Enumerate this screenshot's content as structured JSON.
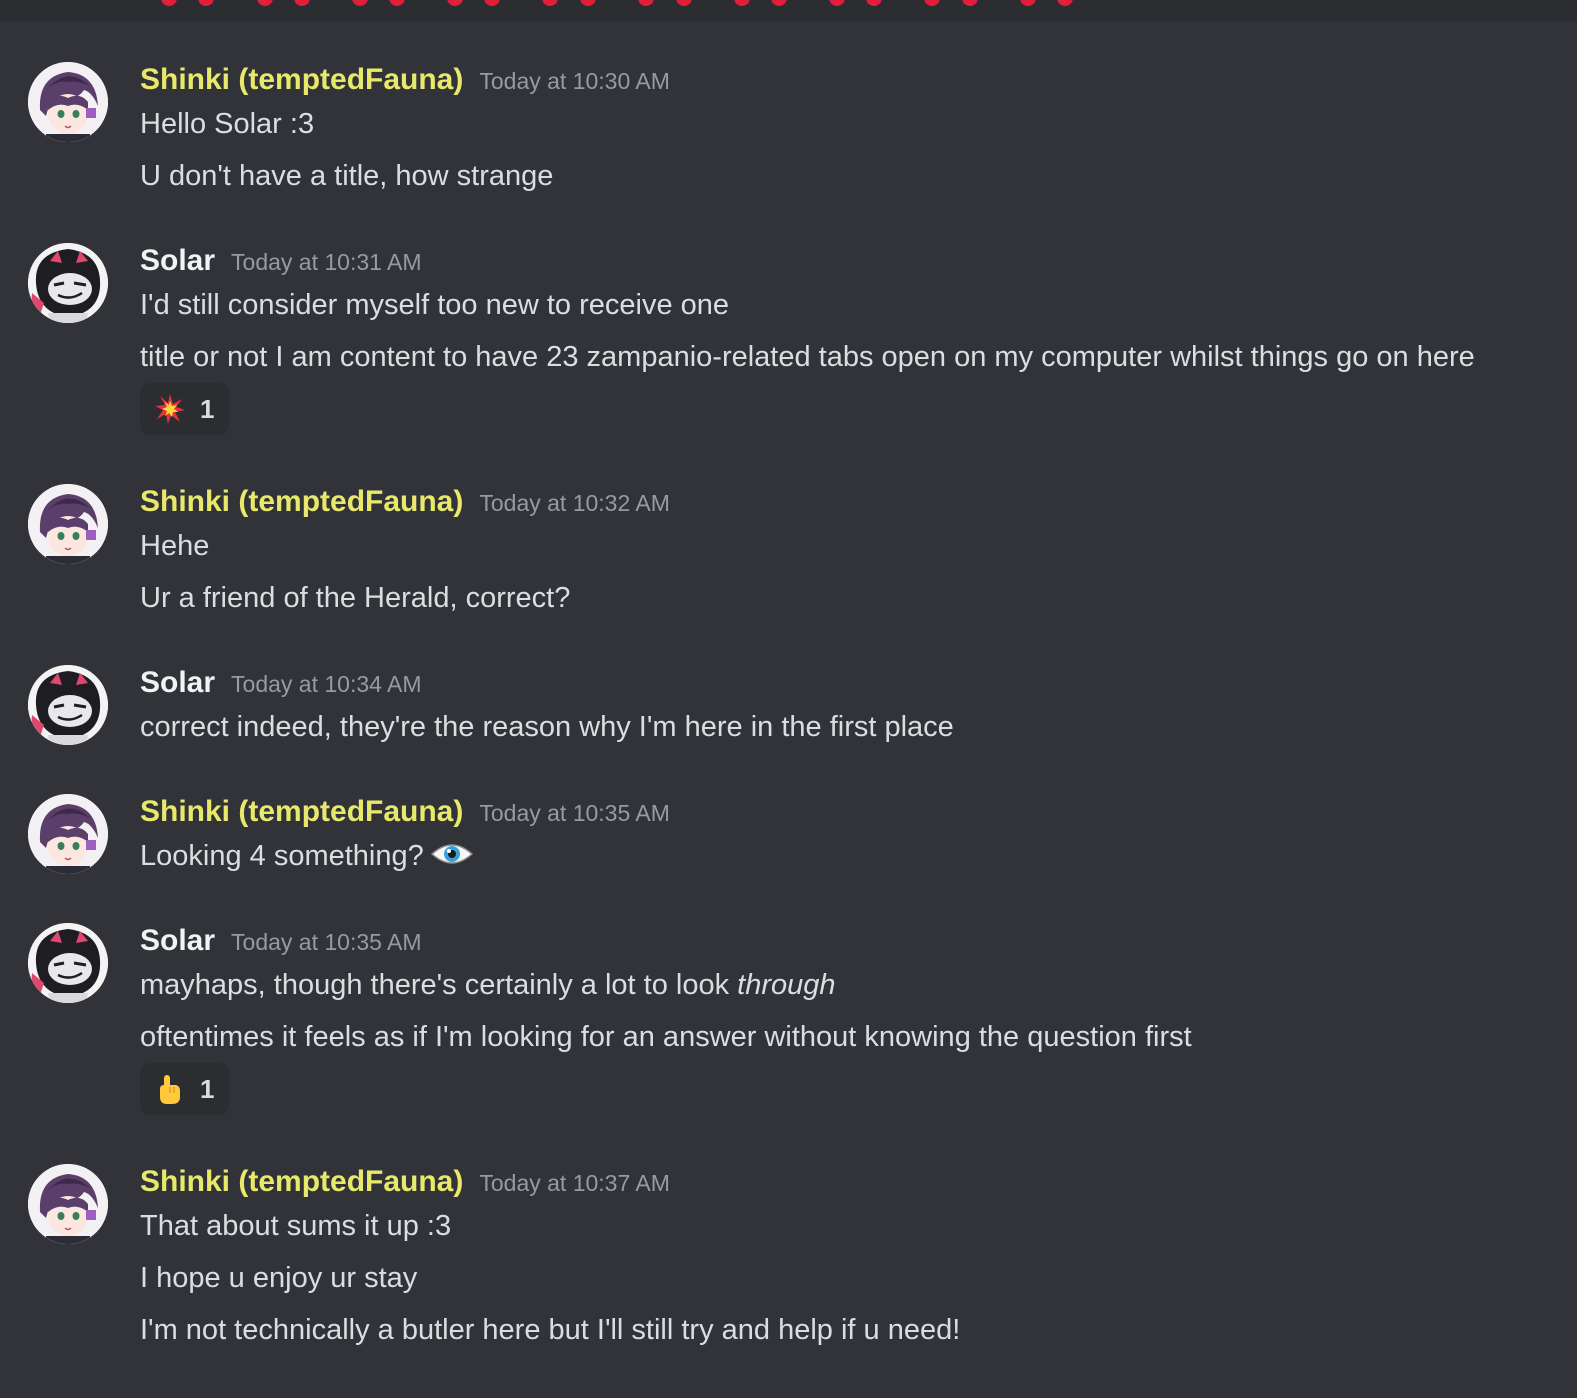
{
  "theme": {
    "background": "#313338",
    "shinki_color": "#e8e86b",
    "solar_color": "#f2f3f5",
    "timestamp_color": "#949ba4",
    "dots_color": "#e0203a"
  },
  "messages": [
    {
      "author": "Shinki (temptedFauna)",
      "avatar_icon": "shinki-avatar-icon",
      "timestamp": "Today at 10:30 AM",
      "lines": [
        "Hello Solar :3",
        "U don't have a title, how strange"
      ]
    },
    {
      "author": "Solar",
      "avatar_icon": "solar-avatar-icon",
      "timestamp": "Today at 10:31 AM",
      "lines": [
        "I'd still consider myself too new to receive one",
        "title or not I am content to have 23 zampanio-related tabs open on my computer whilst things go on here"
      ],
      "reaction": {
        "emoji": "collision-emoji",
        "count": "1"
      }
    },
    {
      "author": "Shinki (temptedFauna)",
      "avatar_icon": "shinki-avatar-icon",
      "timestamp": "Today at 10:32 AM",
      "lines": [
        "Hehe",
        "Ur a friend of the Herald, correct?"
      ]
    },
    {
      "author": "Solar",
      "avatar_icon": "solar-avatar-icon",
      "timestamp": "Today at 10:34 AM",
      "lines": [
        "correct indeed, they're the reason why I'm here in the first place"
      ]
    },
    {
      "author": "Shinki (temptedFauna)",
      "avatar_icon": "shinki-avatar-icon",
      "timestamp": "Today at 10:35 AM",
      "lines": [
        "Looking 4 something?"
      ],
      "inline_emoji": "eye-emoji"
    },
    {
      "author": "Solar",
      "avatar_icon": "solar-avatar-icon",
      "timestamp": "Today at 10:35 AM",
      "lines": [
        "mayhaps, though there's certainly a lot to look",
        "oftentimes it feels as if I'm looking for an answer without knowing the question first"
      ],
      "italic_word": "through",
      "reaction": {
        "emoji": "pointing-up-emoji",
        "count": "1"
      }
    },
    {
      "author": "Shinki (temptedFauna)",
      "avatar_icon": "shinki-avatar-icon",
      "timestamp": "Today at 10:37 AM",
      "lines": [
        "That about sums it up :3",
        "I hope u enjoy ur stay",
        "I'm not technically a butler here but I'll still try and help if u need!"
      ]
    }
  ]
}
